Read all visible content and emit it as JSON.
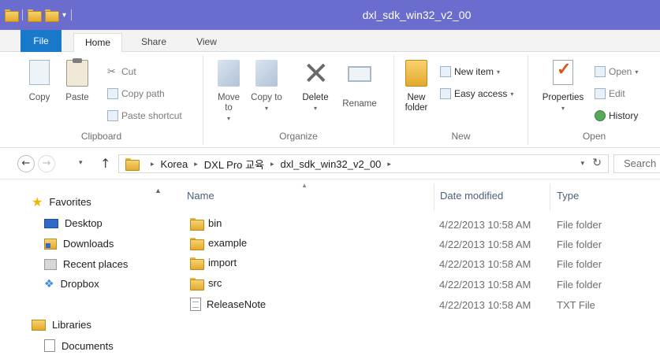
{
  "window": {
    "title": "dxl_sdk_win32_v2_00"
  },
  "tabs": {
    "file": "File",
    "home": "Home",
    "share": "Share",
    "view": "View"
  },
  "ribbon": {
    "clipboard": {
      "label": "Clipboard",
      "copy": "Copy",
      "paste": "Paste",
      "cut": "Cut",
      "copy_path": "Copy path",
      "paste_shortcut": "Paste shortcut"
    },
    "organize": {
      "label": "Organize",
      "move_to": "Move to",
      "copy_to": "Copy to",
      "delete": "Delete",
      "rename": "Rename"
    },
    "new": {
      "label": "New",
      "new_folder": "New folder",
      "new_item": "New item",
      "easy_access": "Easy access"
    },
    "open": {
      "label": "Open",
      "properties": "Properties",
      "open": "Open",
      "edit": "Edit",
      "history": "History"
    }
  },
  "address": {
    "crumbs": [
      "Korea",
      "DXL Pro 교육",
      "dxl_sdk_win32_v2_00"
    ],
    "search_placeholder": "Search"
  },
  "navpane": {
    "favorites": "Favorites",
    "items": [
      "Desktop",
      "Downloads",
      "Recent places",
      "Dropbox"
    ],
    "libraries": "Libraries",
    "library_items": [
      "Documents"
    ]
  },
  "filelist": {
    "columns": {
      "name": "Name",
      "date": "Date modified",
      "type": "Type"
    },
    "rows": [
      {
        "name": "bin",
        "date": "4/22/2013 10:58 AM",
        "type": "File folder",
        "icon": "folder-icon"
      },
      {
        "name": "example",
        "date": "4/22/2013 10:58 AM",
        "type": "File folder",
        "icon": "folder-icon"
      },
      {
        "name": "import",
        "date": "4/22/2013 10:58 AM",
        "type": "File folder",
        "icon": "folder-icon"
      },
      {
        "name": "src",
        "date": "4/22/2013 10:58 AM",
        "type": "File folder",
        "icon": "folder-icon"
      },
      {
        "name": "ReleaseNote",
        "date": "4/22/2013 10:58 AM",
        "type": "TXT File",
        "icon": "text-file-icon"
      }
    ]
  },
  "colors": {
    "titlebar": "#6a6cce",
    "file_tab": "#1979ca",
    "folder": "#e4a92a"
  }
}
